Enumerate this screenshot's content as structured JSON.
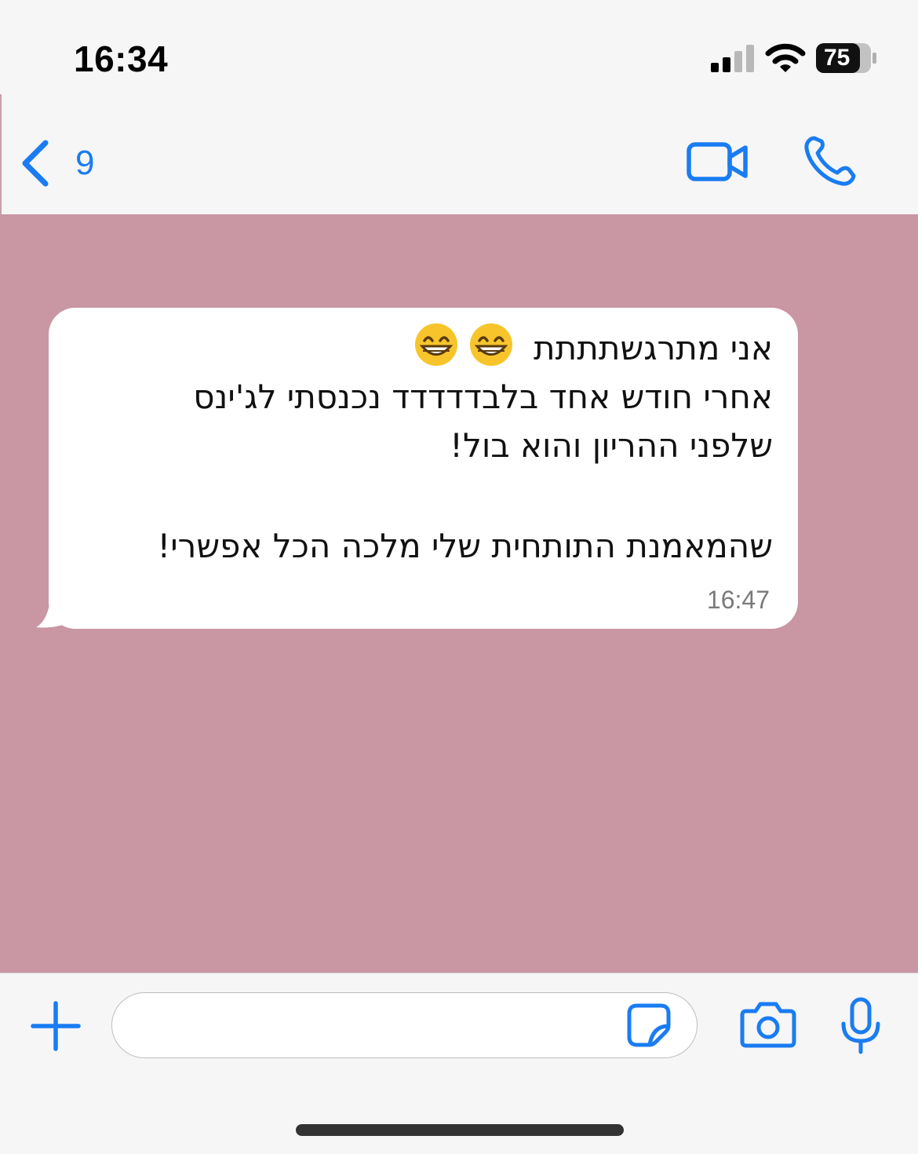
{
  "status_bar": {
    "time": "16:34",
    "battery_level": "75",
    "signal_bars_active": 2,
    "signal_bars_total": 4,
    "icons": [
      "signal-icon",
      "wifi-icon",
      "battery-icon"
    ]
  },
  "header": {
    "back_count": "9",
    "icons": [
      "chevron-left-icon",
      "video-camera-icon",
      "phone-icon"
    ],
    "accent_color": "#1a7cf2"
  },
  "chat": {
    "background_color": "#c996a3",
    "messages": [
      {
        "direction": "incoming",
        "lines": [
          "אני מתרגשתתתת",
          "אחרי חודש אחד בלבדדדדד נכנסתי לג'ינס",
          "שלפני ההריון והוא בול!",
          "שהמאמנת התותחית שלי מלכה הכל אפשרי!"
        ],
        "emojis": [
          "grinning-face-emoji",
          "grinning-face-emoji"
        ],
        "time": "16:47"
      }
    ]
  },
  "composer": {
    "placeholder": "",
    "value": "",
    "icons": [
      "plus-icon",
      "sticker-icon",
      "camera-icon",
      "microphone-icon"
    ]
  }
}
